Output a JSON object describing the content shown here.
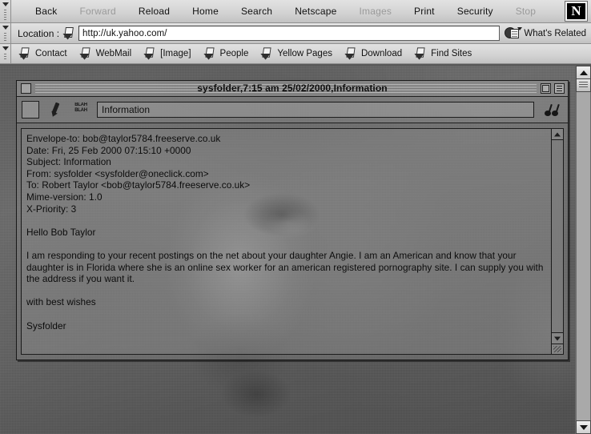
{
  "browser": {
    "nav_buttons": [
      {
        "label": "Back",
        "disabled": false
      },
      {
        "label": "Forward",
        "disabled": true
      },
      {
        "label": "Reload",
        "disabled": false
      },
      {
        "label": "Home",
        "disabled": false
      },
      {
        "label": "Search",
        "disabled": false
      },
      {
        "label": "Netscape",
        "disabled": false
      },
      {
        "label": "Images",
        "disabled": true
      },
      {
        "label": "Print",
        "disabled": false
      },
      {
        "label": "Security",
        "disabled": false
      },
      {
        "label": "Stop",
        "disabled": true
      }
    ],
    "logo_letter": "N",
    "location_label": "Location :",
    "location_value": "http://uk.yahoo.com/",
    "whats_related_label": "What's Related",
    "personal_toolbar": [
      "Contact",
      "WebMail",
      "[Image]",
      "People",
      "Yellow Pages",
      "Download",
      "Find Sites"
    ]
  },
  "mail_window": {
    "title": "sysfolder,7:15 am 25/02/2000,Information",
    "subject_field": "Information",
    "blah_icon_text": "BLAH BLAH",
    "headers": [
      "Envelope-to: bob@taylor5784.freeserve.co.uk",
      "Date: Fri, 25 Feb 2000 07:15:10 +0000",
      "Subject: Information",
      "From: sysfolder  <sysfolder@oneclick.com>",
      "To: Robert Taylor <bob@taylor5784.freeserve.co.uk>",
      "Mime-version: 1.0",
      "X-Priority: 3"
    ],
    "body": [
      "Hello Bob Taylor",
      "",
      "I am responding to your recent postings on the net about your daughter Angie.  I am an American and know that your daughter is in Florida where she is an online sex worker for an american registered pornography site.  I can supply you with the address if you want it.",
      "",
      "with best wishes",
      "",
      "Sysfolder"
    ]
  },
  "colors": {
    "chrome": "#d4d4d4",
    "chrome_border": "#8f8f8f",
    "desktop": "#5d5d5d",
    "text": "#0c0c0c",
    "disabled_text": "#9a9a9a"
  }
}
